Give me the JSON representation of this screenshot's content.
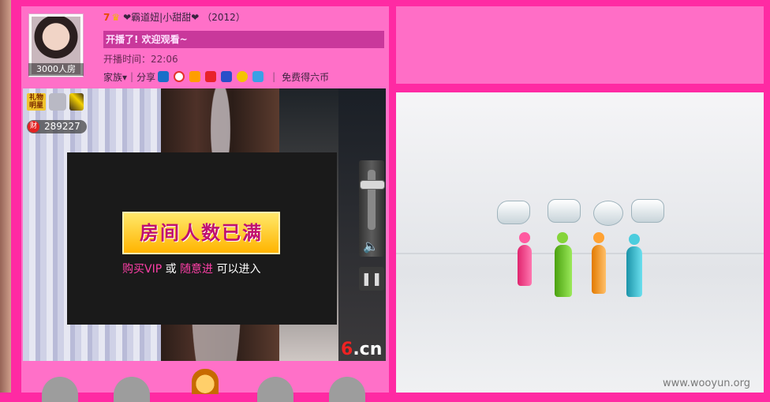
{
  "room": {
    "avatar_caption": "3000人房",
    "host_level": "7",
    "host_name": "❤霸道妞|小甜甜❤",
    "host_year": "（2012）",
    "announcement": "开播了! 欢迎观看~",
    "start_time": "开播时间：22:06"
  },
  "toolbar": {
    "family": "家族",
    "share": "分享",
    "free_coins": "免费得六币",
    "share_icons": [
      "renren-icon",
      "weibo-icon",
      "star-icon",
      "tencent-icon",
      "baidu-icon",
      "qzone-icon",
      "qq-icon"
    ]
  },
  "video": {
    "gift_star_label": "礼物明星",
    "wealth_icon": "财",
    "wealth_value": "289227",
    "full_title": "房间人数已满",
    "buy_vip": "购买VIP",
    "or": "或",
    "random_enter": "随意进",
    "can_enter": "可以进入",
    "logo_six": "6",
    "logo_cn": ".cn"
  },
  "watermark": "www.wooyun.org"
}
